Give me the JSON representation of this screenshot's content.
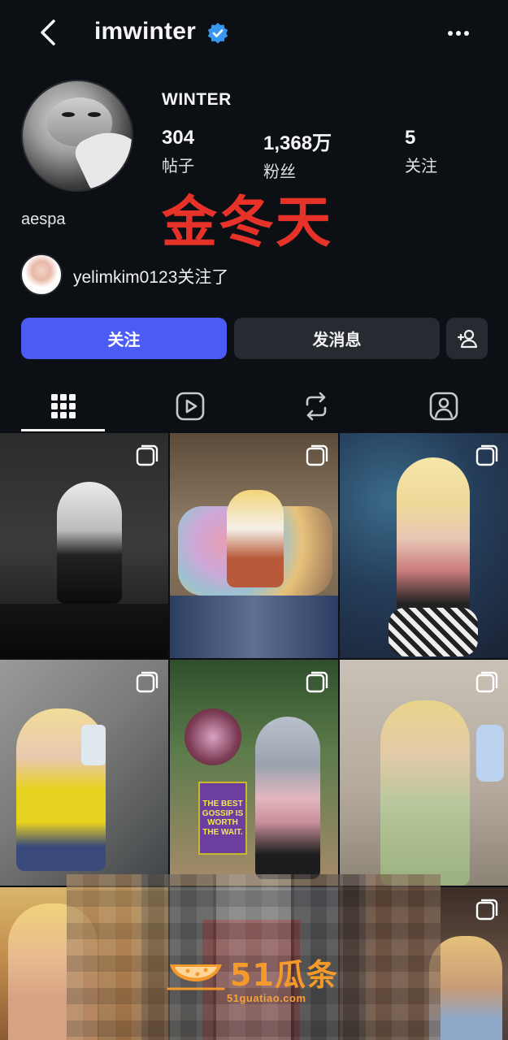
{
  "header": {
    "username": "imwinter",
    "back_icon": "chevron-left-icon",
    "verified_icon": "verified-badge-icon",
    "more_icon": "more-dots-icon"
  },
  "profile": {
    "display_name": "WINTER",
    "group": "aespa",
    "stats": {
      "posts": {
        "value": "304",
        "label": "帖子"
      },
      "followers": {
        "value": "1,368万",
        "label": "粉丝"
      },
      "following": {
        "value": "5",
        "label": "关注"
      }
    },
    "overlay_name": "金冬天",
    "mutual": {
      "username": "yelimkim0123",
      "suffix": "关注了"
    }
  },
  "actions": {
    "follow_label": "关注",
    "message_label": "发消息",
    "add_user_icon": "add-user-icon",
    "follow_color": "#4b5cf5"
  },
  "tabs": [
    {
      "name": "grid",
      "icon": "grid-icon",
      "active": true
    },
    {
      "name": "reels",
      "icon": "reels-icon",
      "active": false
    },
    {
      "name": "reposts",
      "icon": "repost-icon",
      "active": false
    },
    {
      "name": "tagged",
      "icon": "tagged-icon",
      "active": false
    }
  ],
  "posts": {
    "sign_text": "THE BEST GOSSIP IS WORTH THE WAIT."
  },
  "watermark": {
    "brand": "51瓜条",
    "url": "51guatiao.com",
    "color": "#f39a2a"
  }
}
